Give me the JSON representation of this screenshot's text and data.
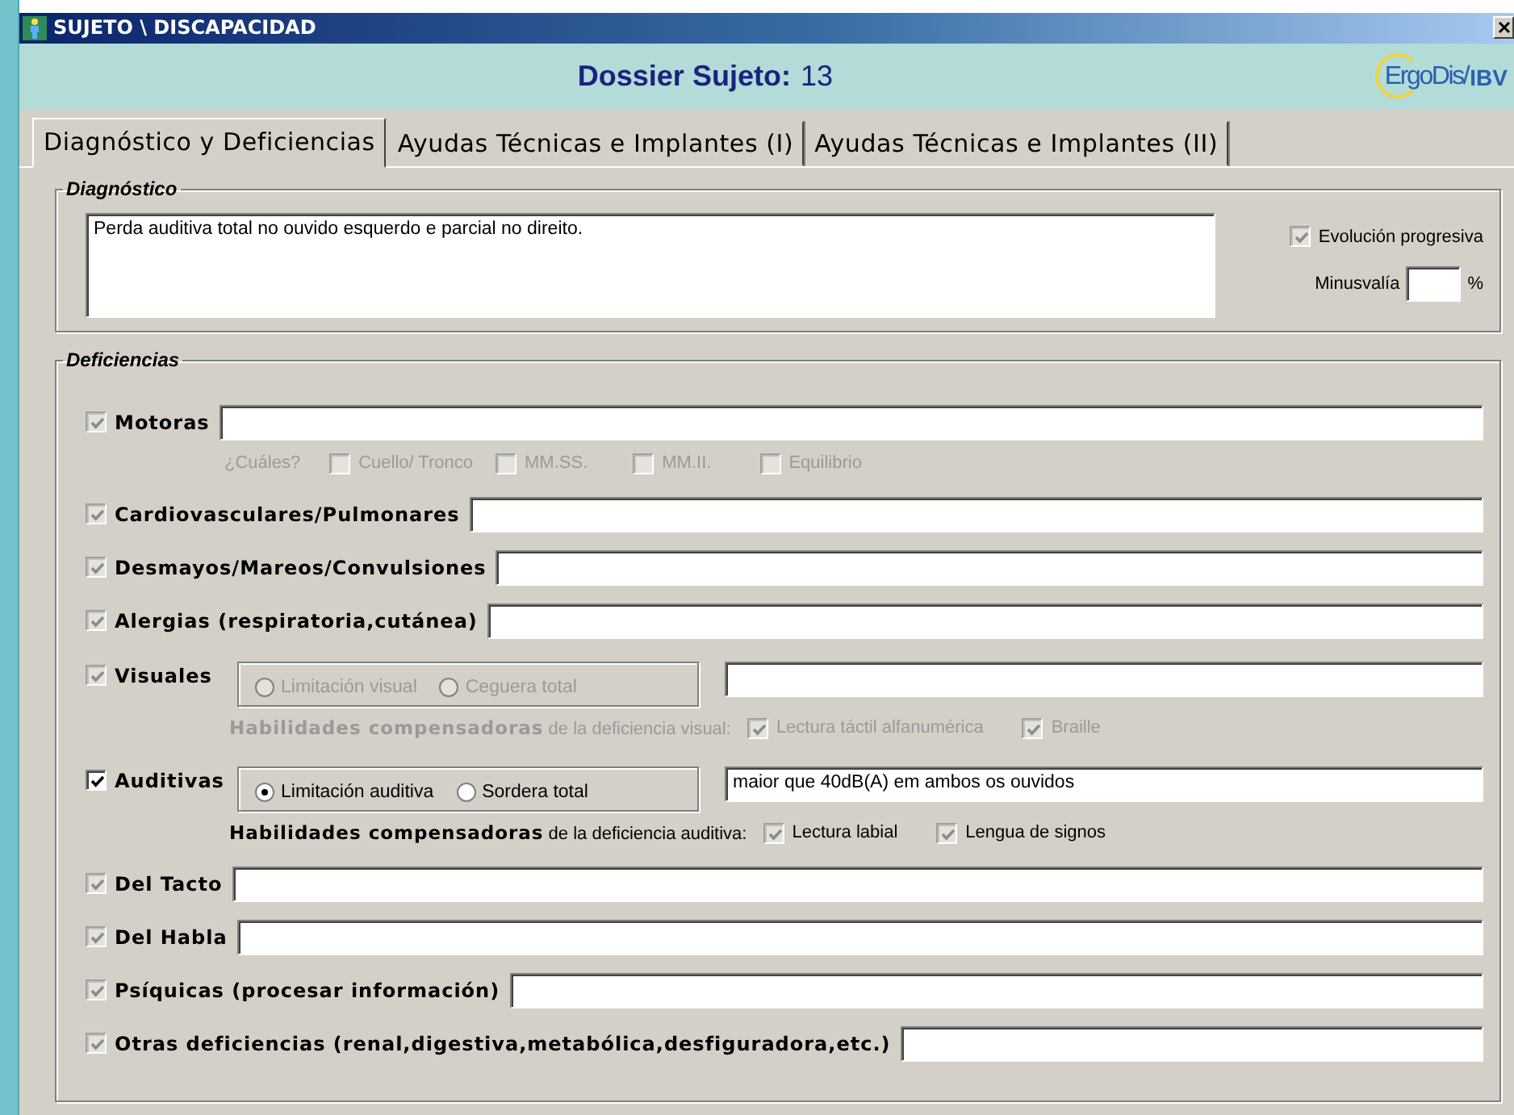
{
  "window": {
    "title": "SUJETO \\ DISCAPACIDAD"
  },
  "header": {
    "label": "Dossier Sujeto:",
    "value": "13",
    "logo": {
      "brand": "ErgoDis/",
      "mark": "IBV"
    }
  },
  "tabs": [
    {
      "label": "Diagnóstico y Deficiencias",
      "selected": true
    },
    {
      "label": "Ayudas Técnicas e Implantes (I)",
      "selected": false
    },
    {
      "label": "Ayudas Técnicas e Implantes (II)",
      "selected": false
    }
  ],
  "diagnostico": {
    "title": "Diagnóstico",
    "text": "Perda auditiva total no ouvido esquerdo e parcial no direito.",
    "evolucion": {
      "label": "Evolución progresiva",
      "checked": true,
      "disabled": true
    },
    "minusvalia": {
      "label": "Minusvalía",
      "unit": "%"
    }
  },
  "deficiencias": {
    "title": "Deficiencias",
    "rows": [
      {
        "kind": "field",
        "label": "Motoras",
        "checked": true,
        "disabled": true,
        "options": {
          "label": "¿Cuáles?",
          "items": [
            {
              "label": "Cuello/ Tronco",
              "checked": false,
              "disabled": true
            },
            {
              "label": "MM.SS.",
              "checked": false,
              "disabled": true
            },
            {
              "label": "MM.II.",
              "checked": false,
              "disabled": true
            },
            {
              "label": "Equilibrio",
              "checked": false,
              "disabled": true
            }
          ]
        }
      },
      {
        "kind": "field",
        "label": "Cardiovasculares/Pulmonares",
        "checked": true,
        "disabled": true
      },
      {
        "kind": "field",
        "label": "Desmayos/Mareos/Convulsiones",
        "checked": true,
        "disabled": true
      },
      {
        "kind": "field",
        "label": "Alergias (respiratoria,cutánea)",
        "checked": true,
        "disabled": true
      },
      {
        "kind": "radio",
        "label": "Visuales",
        "checked": true,
        "disabled": true,
        "radios": [
          {
            "label": "Limitación visual",
            "selected": false
          },
          {
            "label": "Ceguera total",
            "selected": false
          }
        ],
        "skills": {
          "text": "**Habilidades compensadoras** de la deficiencia visual:",
          "items": [
            {
              "label": "Lectura táctil alfanumérica",
              "checked": true,
              "disabled": true
            },
            {
              "label": "Braille",
              "checked": true,
              "disabled": true
            }
          ]
        }
      },
      {
        "kind": "radio",
        "label": "Auditivas",
        "checked": true,
        "disabled": false,
        "radios": [
          {
            "label": "Limitación auditiva",
            "selected": true
          },
          {
            "label": "Sordera total",
            "selected": false
          }
        ],
        "value": "maior que 40dB(A) em ambos os ouvidos",
        "skills": {
          "text": "**Habilidades compensadoras** de la deficiencia auditiva:",
          "items": [
            {
              "label": "Lectura labial",
              "checked": true,
              "disabled": true
            },
            {
              "label": "Lengua de signos",
              "checked": true,
              "disabled": true
            }
          ]
        }
      },
      {
        "kind": "field",
        "label": "Del Tacto",
        "checked": true,
        "disabled": true
      },
      {
        "kind": "field",
        "label": "Del Habla",
        "checked": true,
        "disabled": true
      },
      {
        "kind": "field",
        "label": "Psíquicas (procesar información)",
        "checked": true,
        "disabled": true
      },
      {
        "kind": "field",
        "label": "Otras deficiencias (renal,digestiva,metabólica,desfiguradora,etc.)",
        "checked": true,
        "disabled": true
      }
    ]
  }
}
